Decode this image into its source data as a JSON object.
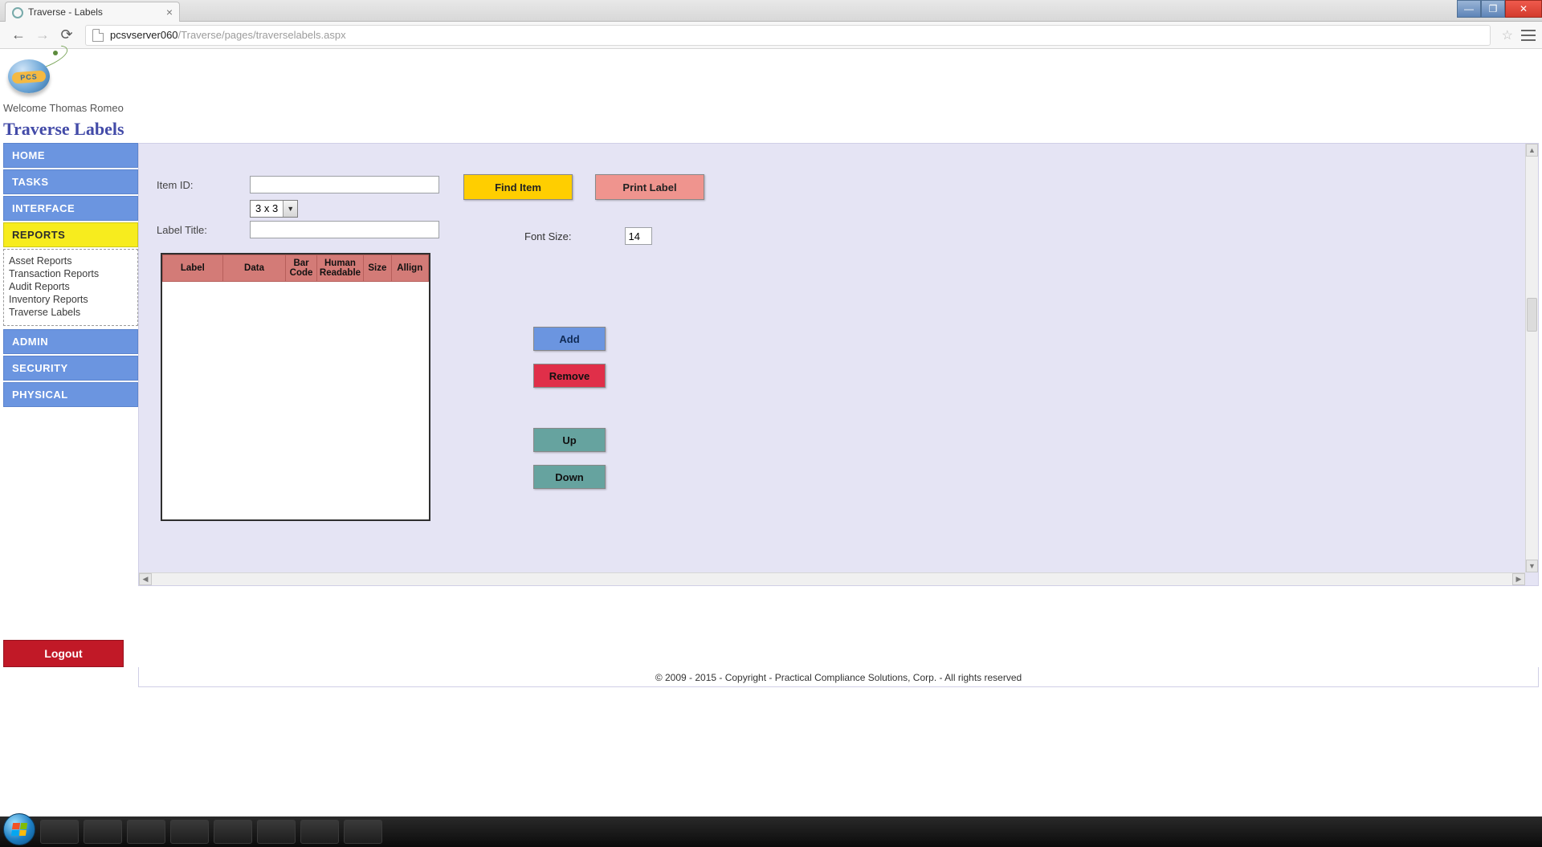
{
  "browser": {
    "tab_title": "Traverse - Labels",
    "url_host": "pcsvserver060",
    "url_path": "/Traverse/pages/traverselabels.aspx"
  },
  "header": {
    "welcome": "Welcome Thomas Romeo",
    "page_title": "Traverse Labels",
    "logo_text": "PCS"
  },
  "sidebar": {
    "items": [
      {
        "label": "HOME"
      },
      {
        "label": "TASKS"
      },
      {
        "label": "INTERFACE"
      },
      {
        "label": "REPORTS"
      },
      {
        "label": "ADMIN"
      },
      {
        "label": "SECURITY"
      },
      {
        "label": "PHYSICAL"
      }
    ],
    "reports_sub": [
      "Asset Reports",
      "Transaction Reports",
      "Audit Reports",
      "Inventory Reports",
      "Traverse Labels"
    ],
    "logout": "Logout"
  },
  "form": {
    "item_id_label": "Item ID:",
    "item_id_value": "",
    "label_title_label": "Label Title:",
    "label_title_value": "",
    "layout_select": "3 x 3",
    "find_item": "Find Item",
    "print_label": "Print Label",
    "font_size_label": "Font Size:",
    "font_size_value": "14"
  },
  "table": {
    "headers": [
      "Label",
      "Data",
      "Bar Code",
      "Human Readable",
      "Size",
      "Allign"
    ]
  },
  "actions": {
    "add": "Add",
    "remove": "Remove",
    "up": "Up",
    "down": "Down"
  },
  "footer": "© 2009 - 2015 - Copyright - Practical Compliance Solutions, Corp. - All rights reserved"
}
